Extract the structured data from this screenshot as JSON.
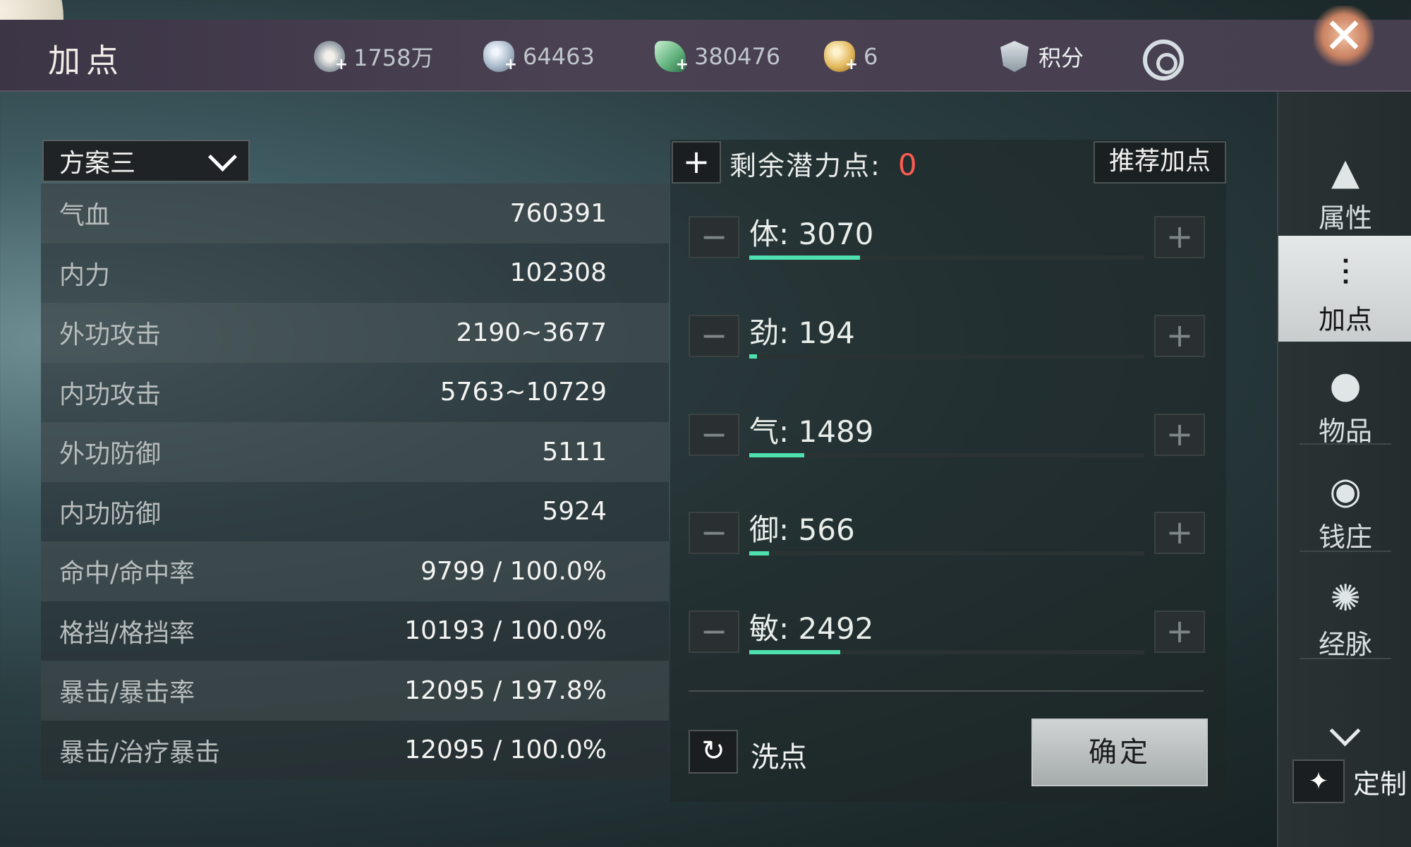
{
  "header": {
    "title": "加点",
    "resources": [
      {
        "icon": "coin-icon",
        "value": "1758万"
      },
      {
        "icon": "silver-ingot-icon",
        "value": "64463"
      },
      {
        "icon": "jade-icon",
        "value": "380476"
      },
      {
        "icon": "gold-ingot-icon",
        "value": "6"
      }
    ],
    "score_label": "积分"
  },
  "scheme": {
    "selected": "方案三"
  },
  "stats": [
    {
      "label": "气血",
      "value": "760391"
    },
    {
      "label": "内力",
      "value": "102308"
    },
    {
      "label": "外功攻击",
      "value": "2190~3677"
    },
    {
      "label": "内功攻击",
      "value": "5763~10729"
    },
    {
      "label": "外功防御",
      "value": "5111"
    },
    {
      "label": "内功防御",
      "value": "5924"
    },
    {
      "label": "命中/命中率",
      "value": "9799 / 100.0%"
    },
    {
      "label": "格挡/格挡率",
      "value": "10193 / 100.0%"
    },
    {
      "label": "暴击/暴击率",
      "value": "12095 / 197.8%"
    },
    {
      "label": "暴击/治疗暴击",
      "value": "12095 / 100.0%"
    }
  ],
  "potential": {
    "label": "剩余潜力点:",
    "value": "0",
    "recommend_label": "推荐加点"
  },
  "attributes": [
    {
      "name": "体: 3070",
      "fill": 0.28
    },
    {
      "name": "劲: 194",
      "fill": 0.02
    },
    {
      "name": "气: 1489",
      "fill": 0.14
    },
    {
      "name": "御: 566",
      "fill": 0.05
    },
    {
      "name": "敏: 2492",
      "fill": 0.23
    }
  ],
  "actions": {
    "reset_label": "洗点",
    "confirm_label": "确定"
  },
  "sidebar": {
    "items": [
      {
        "label": "属性",
        "icon": "hat-icon"
      },
      {
        "label": "加点",
        "icon": "sliders-icon"
      },
      {
        "label": "物品",
        "icon": "bag-icon"
      },
      {
        "label": "钱庄",
        "icon": "money-bag-icon"
      },
      {
        "label": "经脉",
        "icon": "meridian-icon"
      }
    ],
    "custom_label": "定制"
  },
  "colors": {
    "accent_fill": "#4fe0b0",
    "potential_value": "#ff5a50"
  }
}
